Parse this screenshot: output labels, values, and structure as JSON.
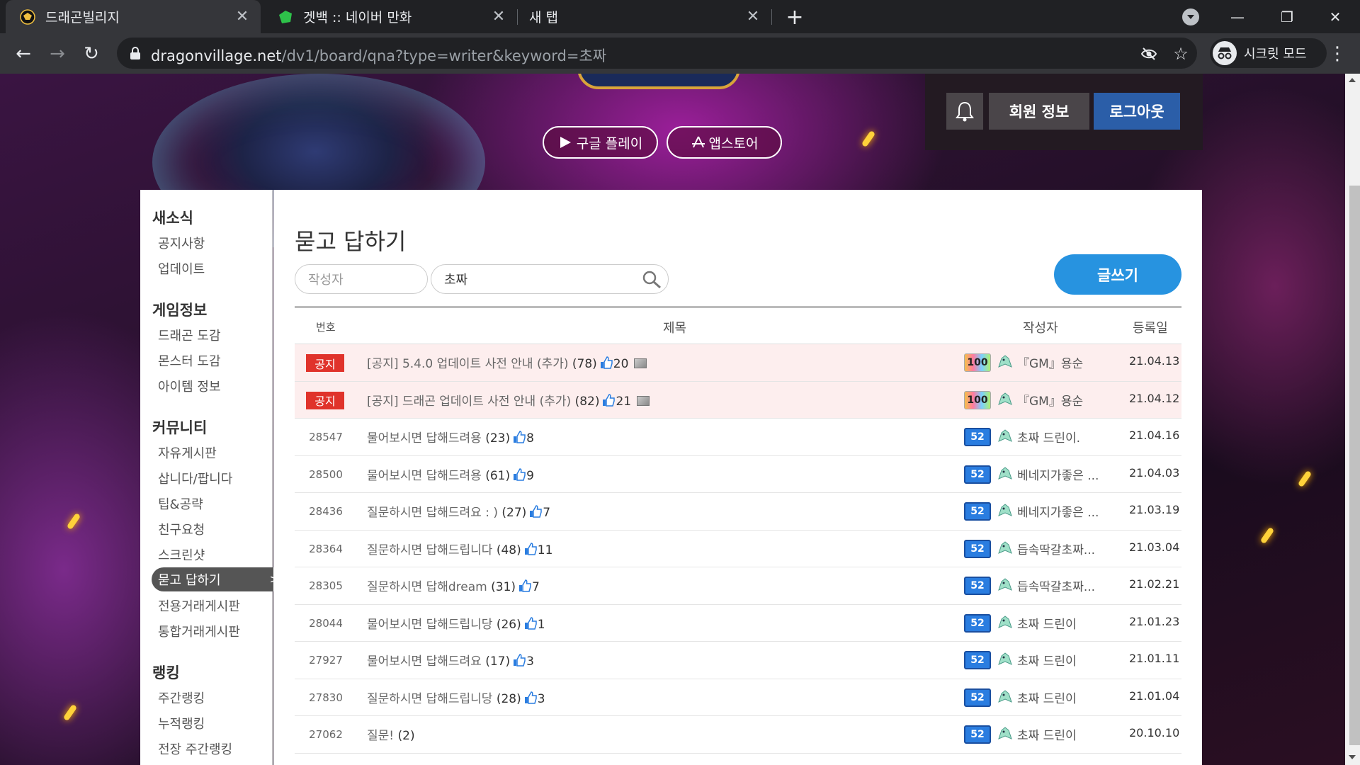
{
  "browser": {
    "tabs": [
      {
        "title": "드래곤빌리지",
        "active": true
      },
      {
        "title": "겟백 :: 네이버 만화",
        "active": false
      },
      {
        "title": "새 탭",
        "active": false
      }
    ],
    "url_host": "dragonvillage.net",
    "url_path": "/dv1/board/qna?type=writer&keyword=초짜",
    "incognito_label": "시크릿 모드"
  },
  "hero": {
    "google_play_label": "구글 플레이",
    "app_store_label": "앱스토어"
  },
  "user": {
    "member_info_label": "회원 정보",
    "logout_label": "로그아웃"
  },
  "sidebar": {
    "sections": [
      {
        "title": "새소식",
        "items": [
          "공지사항",
          "업데이트"
        ]
      },
      {
        "title": "게임정보",
        "items": [
          "드래곤 도감",
          "몬스터 도감",
          "아이템 정보"
        ]
      },
      {
        "title": "커뮤니티",
        "items": [
          "자유게시판",
          "삽니다/팝니다",
          "팁&공략",
          "친구요청",
          "스크린샷",
          "묻고 답하기",
          "전용거래게시판",
          "통합거래게시판"
        ]
      },
      {
        "title": "랭킹",
        "items": [
          "주간랭킹",
          "누적랭킹",
          "전장 주간랭킹"
        ]
      }
    ],
    "active_item": "묻고 답하기"
  },
  "main": {
    "title": "묻고 답하기",
    "search_type": "작성자",
    "search_keyword": "초짜",
    "write_label": "글쓰기",
    "columns": {
      "num": "번호",
      "title": "제목",
      "writer": "작성자",
      "date": "등록일"
    },
    "rows": [
      {
        "num": "",
        "notice": "공지",
        "title": "[공지] 5.4.0 업데이트 사전 안내 (추가)",
        "comments": "(78)",
        "likes": "20",
        "has_image": true,
        "level": "100",
        "writer": "『GM』용순",
        "date": "21.04.13"
      },
      {
        "num": "",
        "notice": "공지",
        "title": "[공지] 드래곤 업데이트 사전 안내 (추가)",
        "comments": "(82)",
        "likes": "21",
        "has_image": true,
        "level": "100",
        "writer": "『GM』용순",
        "date": "21.04.12"
      },
      {
        "num": "28547",
        "notice": "",
        "title": "물어보시면 답해드려용",
        "comments": "(23)",
        "likes": "8",
        "has_image": false,
        "level": "52",
        "writer": "초짜 드린이.",
        "date": "21.04.16"
      },
      {
        "num": "28500",
        "notice": "",
        "title": "물어보시면 답해드려용",
        "comments": "(61)",
        "likes": "9",
        "has_image": false,
        "level": "52",
        "writer": "베네지가좋은 ...",
        "date": "21.04.03"
      },
      {
        "num": "28436",
        "notice": "",
        "title": "질문하시면 답해드려요 : )",
        "comments": "(27)",
        "likes": "7",
        "has_image": false,
        "level": "52",
        "writer": "베네지가좋은 ...",
        "date": "21.03.19"
      },
      {
        "num": "28364",
        "notice": "",
        "title": "질문하시면 답해드립니다",
        "comments": "(48)",
        "likes": "11",
        "has_image": false,
        "level": "52",
        "writer": "듭속딱갈초짜...",
        "date": "21.03.04"
      },
      {
        "num": "28305",
        "notice": "",
        "title": "질문하시면 답해dream",
        "comments": "(31)",
        "likes": "7",
        "has_image": false,
        "level": "52",
        "writer": "듭속딱갈초짜...",
        "date": "21.02.21"
      },
      {
        "num": "28044",
        "notice": "",
        "title": "물어보시면 답해드립니당",
        "comments": "(26)",
        "likes": "1",
        "has_image": false,
        "level": "52",
        "writer": "초짜 드린이",
        "date": "21.01.23"
      },
      {
        "num": "27927",
        "notice": "",
        "title": "물어보시면 답해드려요",
        "comments": "(17)",
        "likes": "3",
        "has_image": false,
        "level": "52",
        "writer": "초짜 드린이",
        "date": "21.01.11"
      },
      {
        "num": "27830",
        "notice": "",
        "title": "질문하시면 답해드립니당",
        "comments": "(28)",
        "likes": "3",
        "has_image": false,
        "level": "52",
        "writer": "초짜 드린이",
        "date": "21.01.04"
      },
      {
        "num": "27062",
        "notice": "",
        "title": "질문!",
        "comments": "(2)",
        "likes": "",
        "has_image": false,
        "level": "52",
        "writer": "초짜 드린이",
        "date": "20.10.10"
      }
    ]
  },
  "colors": {
    "accent_blue": "#2793e0",
    "notice_red": "#e0332b",
    "logout_blue": "#2b5ea8"
  }
}
